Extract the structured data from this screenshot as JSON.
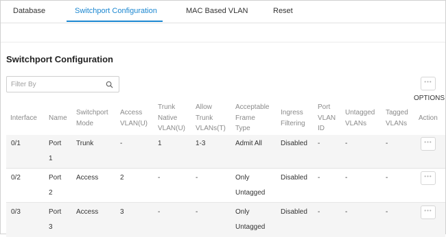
{
  "tabs": [
    {
      "label": "Database",
      "active": false
    },
    {
      "label": "Switchport Configuration",
      "active": true
    },
    {
      "label": "MAC Based VLAN",
      "active": false
    },
    {
      "label": "Reset",
      "active": false
    }
  ],
  "section_title": "Switchport Configuration",
  "filter": {
    "placeholder": "Filter By",
    "value": "",
    "icon": "search-icon"
  },
  "options": {
    "label": "OPTIONS",
    "icon": "more-dots-icon"
  },
  "table": {
    "headers": [
      [
        "Interface"
      ],
      [
        "Name"
      ],
      [
        "Switchport",
        "Mode"
      ],
      [
        "Access",
        "VLAN(U)"
      ],
      [
        "Trunk",
        "Native",
        "VLAN(U)"
      ],
      [
        "Allow",
        "Trunk",
        "VLANs(T)"
      ],
      [
        "Acceptable",
        "Frame",
        "Type"
      ],
      [
        "Ingress",
        "Filtering"
      ],
      [
        "Port",
        "VLAN",
        "ID"
      ],
      [
        "Untagged",
        "VLANs"
      ],
      [
        "Tagged",
        "VLANs"
      ],
      [
        "Action"
      ]
    ],
    "rows": [
      {
        "interface": "0/1",
        "name": [
          "Port",
          "1"
        ],
        "mode": "Trunk",
        "access_vlan": "-",
        "trunk_native": "1",
        "allow_trunk": "1-3",
        "frame_type": [
          "Admit All"
        ],
        "ingress": "Disabled",
        "pvid": "-",
        "untagged": "-",
        "tagged": "-"
      },
      {
        "interface": "0/2",
        "name": [
          "Port",
          "2"
        ],
        "mode": "Access",
        "access_vlan": "2",
        "trunk_native": "-",
        "allow_trunk": "-",
        "frame_type": [
          "Only",
          "Untagged"
        ],
        "ingress": "Disabled",
        "pvid": "-",
        "untagged": "-",
        "tagged": "-"
      },
      {
        "interface": "0/3",
        "name": [
          "Port",
          "3"
        ],
        "mode": "Access",
        "access_vlan": "3",
        "trunk_native": "-",
        "allow_trunk": "-",
        "frame_type": [
          "Only",
          "Untagged"
        ],
        "ingress": "Disabled",
        "pvid": "-",
        "untagged": "-",
        "tagged": "-"
      }
    ]
  },
  "colors": {
    "accent": "#1a86d0",
    "alt_row": "#f5f5f5"
  }
}
